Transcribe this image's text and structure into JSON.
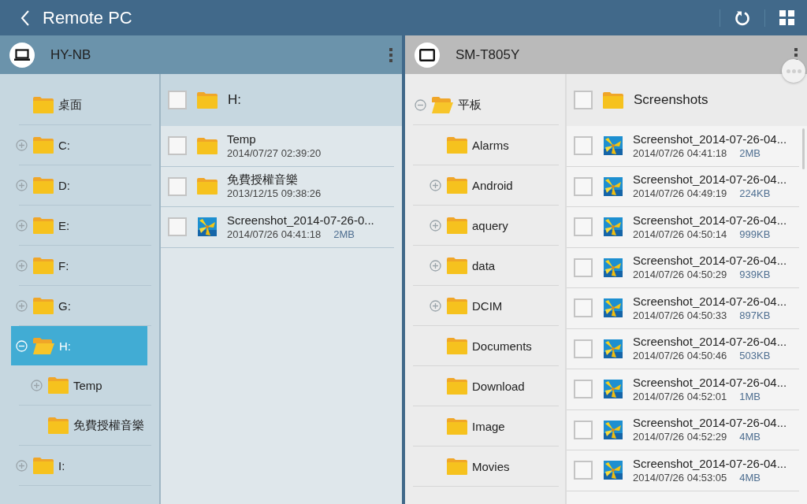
{
  "app_bar": {
    "title": "Remote PC"
  },
  "panels": [
    {
      "device": "HY-NB",
      "kind": "laptop",
      "active": true,
      "tree": [
        {
          "label": "桌面",
          "expandable": false,
          "expanded": false,
          "selected": false
        },
        {
          "label": "C:",
          "expandable": true,
          "expanded": false,
          "selected": false
        },
        {
          "label": "D:",
          "expandable": true,
          "expanded": false,
          "selected": false
        },
        {
          "label": "E:",
          "expandable": true,
          "expanded": false,
          "selected": false
        },
        {
          "label": "F:",
          "expandable": true,
          "expanded": false,
          "selected": false
        },
        {
          "label": "G:",
          "expandable": true,
          "expanded": false,
          "selected": false
        },
        {
          "label": "H:",
          "expandable": true,
          "expanded": true,
          "selected": true,
          "children": [
            {
              "label": "Temp",
              "expandable": true,
              "expanded": false,
              "selected": false
            },
            {
              "label": "免費授權音樂",
              "expandable": false,
              "expanded": false,
              "selected": false
            }
          ]
        },
        {
          "label": "I:",
          "expandable": true,
          "expanded": false,
          "selected": false
        }
      ],
      "current_folder": {
        "name": "H:",
        "checked": false
      },
      "files": [
        {
          "kind": "folder",
          "name": "Temp",
          "date": "2014/07/27 02:39:20",
          "checked": false
        },
        {
          "kind": "folder",
          "name": "免費授權音樂",
          "date": "2013/12/15 09:38:26",
          "checked": false
        },
        {
          "name": "Screenshot_2014-07-26-0...",
          "date": "2014/07/26 04:41:18",
          "size": "2MB",
          "checked": false
        }
      ]
    },
    {
      "device": "SM-T805Y",
      "kind": "tablet",
      "active": false,
      "tree": [
        {
          "label": "平板",
          "expandable": true,
          "expanded": true,
          "selected": false,
          "children": [
            {
              "label": "Alarms",
              "expandable": false,
              "expanded": false,
              "selected": false
            },
            {
              "label": "Android",
              "expandable": true,
              "expanded": false,
              "selected": false
            },
            {
              "label": "aquery",
              "expandable": true,
              "expanded": false,
              "selected": false
            },
            {
              "label": "data",
              "expandable": true,
              "expanded": false,
              "selected": false
            },
            {
              "label": "DCIM",
              "expandable": true,
              "expanded": false,
              "selected": false
            },
            {
              "label": "Documents",
              "expandable": false,
              "expanded": false,
              "selected": false
            },
            {
              "label": "Download",
              "expandable": false,
              "expanded": false,
              "selected": false
            },
            {
              "label": "Image",
              "expandable": false,
              "expanded": false,
              "selected": false
            },
            {
              "label": "Movies",
              "expandable": false,
              "expanded": false,
              "selected": false
            }
          ]
        }
      ],
      "current_folder": {
        "name": "Screenshots",
        "checked": false
      },
      "files": [
        {
          "name": "Screenshot_2014-07-26-04...",
          "date": "2014/07/26 04:41:18",
          "size": "2MB",
          "checked": false
        },
        {
          "name": "Screenshot_2014-07-26-04...",
          "date": "2014/07/26 04:49:19",
          "size": "224KB",
          "checked": false
        },
        {
          "name": "Screenshot_2014-07-26-04...",
          "date": "2014/07/26 04:50:14",
          "size": "999KB",
          "checked": false
        },
        {
          "name": "Screenshot_2014-07-26-04...",
          "date": "2014/07/26 04:50:29",
          "size": "939KB",
          "checked": false
        },
        {
          "name": "Screenshot_2014-07-26-04...",
          "date": "2014/07/26 04:50:33",
          "size": "897KB",
          "checked": false
        },
        {
          "name": "Screenshot_2014-07-26-04...",
          "date": "2014/07/26 04:50:46",
          "size": "503KB",
          "checked": false
        },
        {
          "name": "Screenshot_2014-07-26-04...",
          "date": "2014/07/26 04:52:01",
          "size": "1MB",
          "checked": false
        },
        {
          "name": "Screenshot_2014-07-26-04...",
          "date": "2014/07/26 04:52:29",
          "size": "4MB",
          "checked": false
        },
        {
          "name": "Screenshot_2014-07-26-04...",
          "date": "2014/07/26 04:53:05",
          "size": "4MB",
          "checked": false
        }
      ]
    }
  ]
}
